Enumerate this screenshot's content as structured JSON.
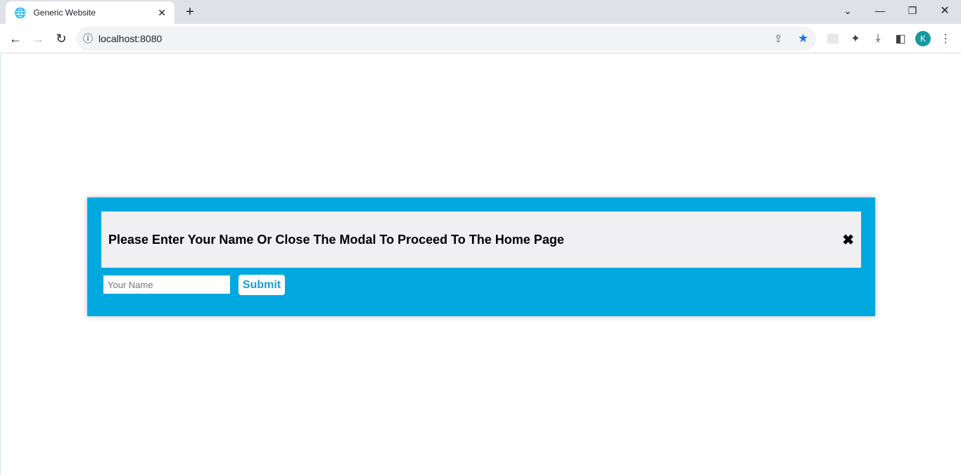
{
  "browser": {
    "tab_title": "Generic Website",
    "url": "localhost:8080",
    "profile_initial": "K",
    "icons": [
      "globe-icon",
      "close-icon",
      "plus-icon",
      "chevron-down-icon",
      "minimize-icon",
      "restore-icon",
      "window-close-icon",
      "back-icon",
      "forward-icon",
      "reload-icon",
      "info-icon",
      "share-icon",
      "star-icon",
      "extension-icon",
      "puzzle-icon",
      "download-icon",
      "sidepanel-icon",
      "menu-icon"
    ],
    "star_color": "#1a73e8"
  },
  "modal": {
    "heading": "Please Enter Your Name Or Close The Modal To Proceed To The Home Page",
    "close_glyph": "✖",
    "name_placeholder": "Your Name",
    "name_value": "",
    "submit_label": "Submit",
    "accent_color": "#00a8e0"
  }
}
